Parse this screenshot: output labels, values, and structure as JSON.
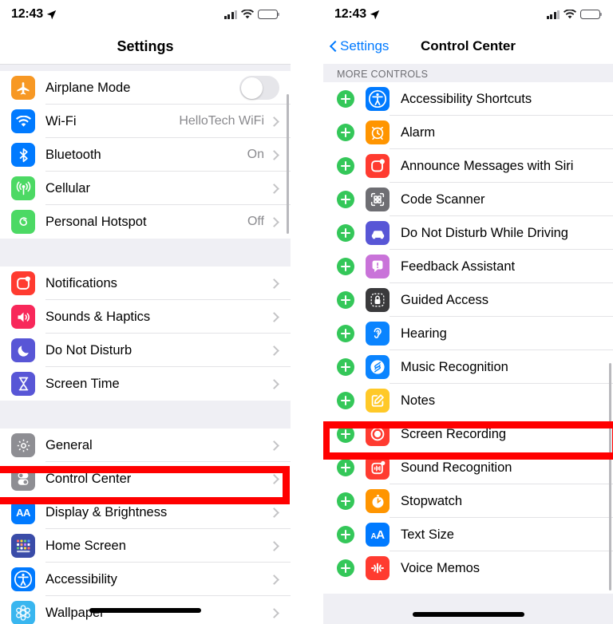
{
  "left": {
    "status": {
      "time": "12:43",
      "location_icon": "location-arrow-icon",
      "signal_icon": "cellular-bars-icon",
      "wifi_icon": "wifi-icon",
      "battery_icon": "battery-icon"
    },
    "nav": {
      "title": "Settings"
    },
    "groups": [
      {
        "rows": [
          {
            "label": "Airplane Mode",
            "value": "",
            "icon": "airplane-icon",
            "color": "#f79824",
            "accessory": "toggle",
            "toggle_on": false
          },
          {
            "label": "Wi-Fi",
            "value": "HelloTech WiFi",
            "icon": "wifi-icon",
            "color": "#007aff",
            "accessory": "chevron"
          },
          {
            "label": "Bluetooth",
            "value": "On",
            "icon": "bluetooth-icon",
            "color": "#007aff",
            "accessory": "chevron"
          },
          {
            "label": "Cellular",
            "value": "",
            "icon": "cellular-antenna-icon",
            "color": "#4cd964",
            "accessory": "chevron"
          },
          {
            "label": "Personal Hotspot",
            "value": "Off",
            "icon": "personal-hotspot-icon",
            "color": "#4cd964",
            "accessory": "chevron"
          }
        ]
      },
      {
        "rows": [
          {
            "label": "Notifications",
            "value": "",
            "icon": "notifications-icon",
            "color": "#ff3b30",
            "accessory": "chevron"
          },
          {
            "label": "Sounds & Haptics",
            "value": "",
            "icon": "sounds-haptics-icon",
            "color": "#f8285a",
            "accessory": "chevron"
          },
          {
            "label": "Do Not Disturb",
            "value": "",
            "icon": "moon-icon",
            "color": "#5856d6",
            "accessory": "chevron"
          },
          {
            "label": "Screen Time",
            "value": "",
            "icon": "hourglass-icon",
            "color": "#5856d6",
            "accessory": "chevron"
          }
        ]
      },
      {
        "rows": [
          {
            "label": "General",
            "value": "",
            "icon": "gear-icon",
            "color": "#8e8e93",
            "accessory": "chevron"
          },
          {
            "label": "Control Center",
            "value": "",
            "icon": "control-center-icon",
            "color": "#8e8e93",
            "accessory": "chevron",
            "highlighted": true
          },
          {
            "label": "Display & Brightness",
            "value": "",
            "icon": "display-brightness-icon",
            "color": "#007aff",
            "accessory": "chevron"
          },
          {
            "label": "Home Screen",
            "value": "",
            "icon": "home-screen-icon",
            "color": "#3a4ca8",
            "accessory": "chevron"
          },
          {
            "label": "Accessibility",
            "value": "",
            "icon": "accessibility-icon",
            "color": "#007aff",
            "accessory": "chevron"
          },
          {
            "label": "Wallpaper",
            "value": "",
            "icon": "wallpaper-icon",
            "color": "#39b6ef",
            "accessory": "chevron"
          }
        ]
      }
    ]
  },
  "right": {
    "status": {
      "time": "12:43",
      "location_icon": "location-arrow-icon",
      "signal_icon": "cellular-bars-icon",
      "wifi_icon": "wifi-icon",
      "battery_icon": "battery-icon"
    },
    "nav": {
      "back_label": "Settings",
      "title": "Control Center"
    },
    "section_header": "MORE CONTROLS",
    "rows": [
      {
        "label": "Accessibility Shortcuts",
        "icon": "accessibility-icon",
        "color": "#007aff"
      },
      {
        "label": "Alarm",
        "icon": "alarm-clock-icon",
        "color": "#ff9500"
      },
      {
        "label": "Announce Messages with Siri",
        "icon": "messages-icon",
        "color": "#ff3b30"
      },
      {
        "label": "Code Scanner",
        "icon": "qr-code-scanner-icon",
        "color": "#6e6e73"
      },
      {
        "label": "Do Not Disturb While Driving",
        "icon": "car-icon",
        "color": "#5856d6"
      },
      {
        "label": "Feedback Assistant",
        "icon": "feedback-assistant-icon",
        "color": "#c973d9"
      },
      {
        "label": "Guided Access",
        "icon": "lock-icon",
        "color": "#3a3a3c"
      },
      {
        "label": "Hearing",
        "icon": "ear-icon",
        "color": "#0a84ff"
      },
      {
        "label": "Music Recognition",
        "icon": "shazam-icon",
        "color": "#0a84ff"
      },
      {
        "label": "Notes",
        "icon": "notes-icon",
        "color": "#ffc928"
      },
      {
        "label": "Screen Recording",
        "icon": "screen-recording-icon",
        "color": "#ff3b30",
        "highlighted": true
      },
      {
        "label": "Sound Recognition",
        "icon": "sound-recognition-icon",
        "color": "#ff3b30"
      },
      {
        "label": "Stopwatch",
        "icon": "stopwatch-icon",
        "color": "#ff9500"
      },
      {
        "label": "Text Size",
        "icon": "text-size-icon",
        "color": "#007aff"
      },
      {
        "label": "Voice Memos",
        "icon": "voice-memos-icon",
        "color": "#ff3b30"
      }
    ],
    "add_button_label": "+"
  },
  "annotations": {
    "highlight_color": "#ff0000",
    "boxes": [
      {
        "target": "Control Center",
        "panel": "left"
      },
      {
        "target": "Screen Recording",
        "panel": "right"
      }
    ]
  }
}
